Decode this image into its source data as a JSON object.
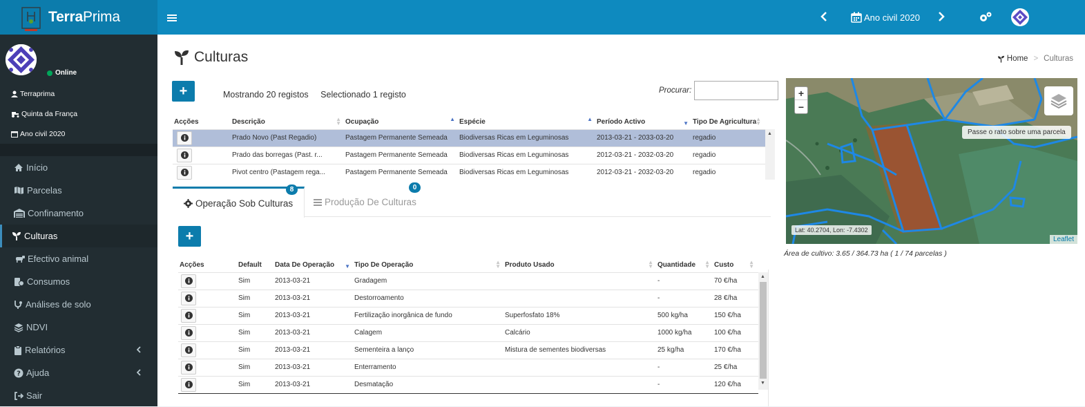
{
  "header": {
    "brand_bold": "Terra",
    "brand_rest": "Prima",
    "year_label": "Ano civil 2020"
  },
  "sidebar": {
    "status": "Online",
    "user": "Terraprima",
    "farm": "Quinta da França",
    "year": "Ano civil 2020",
    "menu": [
      {
        "label": "Início"
      },
      {
        "label": "Parcelas"
      },
      {
        "label": "Confinamento"
      },
      {
        "label": "Culturas"
      },
      {
        "label": "Efectivo animal"
      },
      {
        "label": "Consumos"
      },
      {
        "label": "Análises de solo"
      },
      {
        "label": "NDVI"
      },
      {
        "label": "Relatórios"
      },
      {
        "label": "Ajuda"
      },
      {
        "label": "Sair"
      }
    ]
  },
  "page": {
    "title": "Culturas",
    "breadcrumb_home": "Home",
    "breadcrumb_current": "Culturas",
    "showing": "Mostrando 20 registos",
    "selected": "Selectionado 1 registo",
    "search_label": "Procurar:",
    "search_value": ""
  },
  "crops_table": {
    "headers": [
      "Acções",
      "Descrição",
      "Ocupação",
      "Espécie",
      "Período Activo",
      "Tipo De Agricultura"
    ],
    "rows": [
      [
        "Prado Novo (Past Regadio)",
        "Pastagem Permanente Semeada",
        "Biodiversas Ricas em Leguminosas",
        "2013-03-21 - 2033-03-20",
        "regadio"
      ],
      [
        "Prado das borregas (Past. r...",
        "Pastagem Permanente Semeada",
        "Biodiversas Ricas em Leguminosas",
        "2012-03-21 - 2032-03-20",
        "regadio"
      ],
      [
        "Pivot centro (Pastagem rega...",
        "Pastagem Permanente Semeada",
        "Biodiversas Ricas em Leguminosas",
        "2012-03-21 - 2032-03-20",
        "regadio"
      ]
    ]
  },
  "tabs": [
    {
      "label": "Operação Sob Culturas",
      "badge": "8"
    },
    {
      "label": "Produção De Culturas",
      "badge": "0"
    }
  ],
  "ops_table": {
    "headers": [
      "Acções",
      "Default",
      "Data De Operação",
      "Tipo De Operação",
      "Produto Usado",
      "Quantidade",
      "Custo"
    ],
    "rows": [
      [
        "Sim",
        "2013-03-21",
        "Gradagem",
        "",
        "-",
        "70 €/ha"
      ],
      [
        "Sim",
        "2013-03-21",
        "Destorroamento",
        "",
        "-",
        "28 €/ha"
      ],
      [
        "Sim",
        "2013-03-21",
        "Fertilização inorgânica de fundo",
        "Superfosfato 18%",
        "500 kg/ha",
        "150 €/ha"
      ],
      [
        "Sim",
        "2013-03-21",
        "Calagem",
        "Calcário",
        "1000 kg/ha",
        "100 €/ha"
      ],
      [
        "Sim",
        "2013-03-21",
        "Sementeira a lanço",
        "Mistura de sementes biodiversas",
        "25 kg/ha",
        "170 €/ha"
      ],
      [
        "Sim",
        "2013-03-21",
        "Enterramento",
        "",
        "-",
        "25 €/ha"
      ],
      [
        "Sim",
        "2013-03-21",
        "Desmatação",
        "",
        "-",
        "120 €/ha"
      ]
    ]
  },
  "map": {
    "hover_tip": "Passe o rato sobre uma parcela",
    "coords": "Lat: 40.2704, Lon: -7.4302",
    "attribution": "Leaflet",
    "area_note": "Área de cultivo: 3.65 / 364.73 ha ( 1 / 74 parcelas )",
    "parcel_color": "#1e88e5",
    "selected_color": "#c0392b"
  }
}
